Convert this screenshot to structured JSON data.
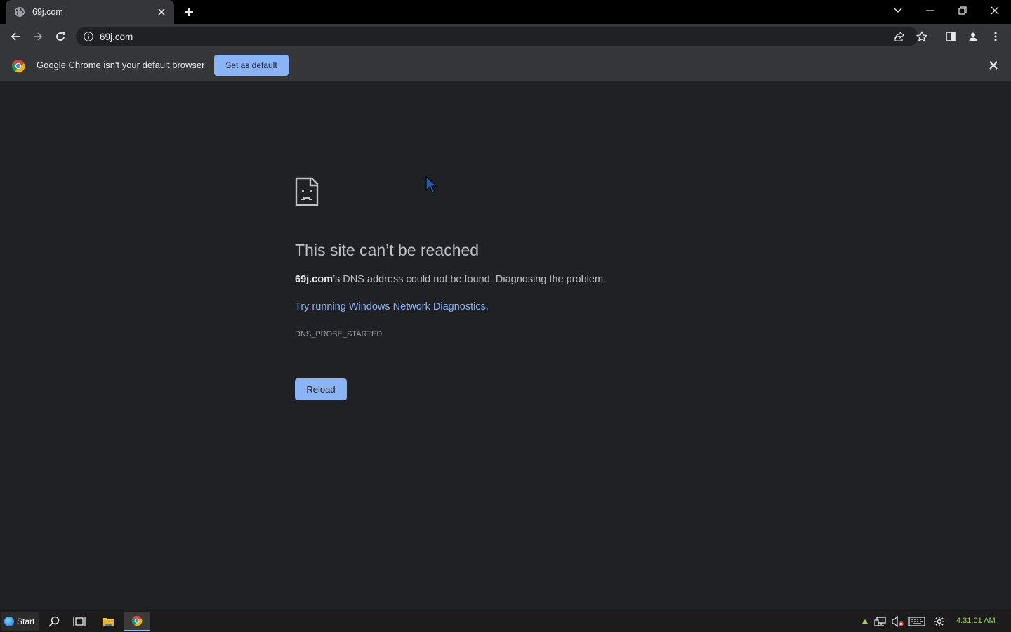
{
  "browser": {
    "tab": {
      "title": "69j.com"
    },
    "omnibox": {
      "url": "69j.com"
    },
    "infobar": {
      "message": "Google Chrome isn't your default browser",
      "set_default_label": "Set as default"
    }
  },
  "error_page": {
    "title": "This site can’t be reached",
    "domain": "69j.com",
    "description_rest": "’s DNS address could not be found. Diagnosing the problem.",
    "link_text": "Try running Windows Network Diagnostics",
    "link_suffix": ".",
    "error_code": "DNS_PROBE_STARTED",
    "reload_label": "Reload"
  },
  "taskbar": {
    "start_label": "Start",
    "clock": "4:31:01 AM"
  },
  "colors": {
    "accent": "#8ab4f8",
    "background": "#202124",
    "clock": "#9fd356"
  }
}
